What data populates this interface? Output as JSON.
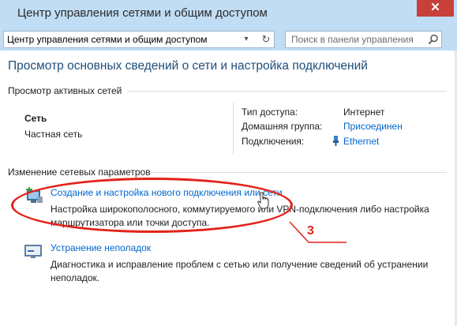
{
  "window": {
    "title": "Центр управления сетями и общим доступом",
    "close_label": "✕"
  },
  "address": {
    "path": "Центр управления сетями и общим доступом",
    "search_placeholder": "Поиск в панели управления"
  },
  "main": {
    "heading": "Просмотр основных сведений о сети и настройка подключений",
    "active_networks_header": "Просмотр активных сетей",
    "network": {
      "name": "Сеть",
      "type": "Частная сеть",
      "rows": [
        {
          "key": "Тип доступа:",
          "value": "Интернет",
          "link": false
        },
        {
          "key": "Домашняя группа:",
          "value": "Присоединен",
          "link": true
        },
        {
          "key": "Подключения:",
          "value": "Ethernet",
          "link": true
        }
      ]
    },
    "change_settings_header": "Изменение сетевых параметров",
    "tasks": [
      {
        "title": "Создание и настройка нового подключения или сети",
        "desc_line1": "Настройка широкополосного, коммутируемого или VPN-подключения либо настройка",
        "desc_line2": "маршрутизатора или точки доступа.",
        "icon": "new-connection-icon"
      },
      {
        "title": "Устранение неполадок",
        "desc_line1": "Диагностика и исправление проблем с сетью или получение сведений об устранении",
        "desc_line2": "неполадок.",
        "icon": "troubleshoot-icon"
      }
    ]
  },
  "annotation": {
    "number": "3",
    "color": "#e2231a"
  },
  "colors": {
    "titlebar": "#c0ddf4",
    "heading": "#1e4e79",
    "link": "#0066cc"
  }
}
